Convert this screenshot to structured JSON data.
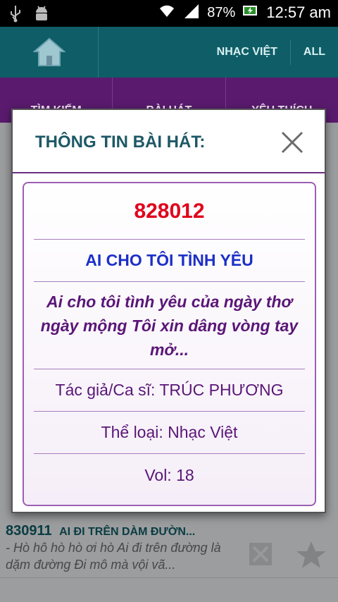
{
  "status_bar": {
    "battery": "87%",
    "time": "12:57 am"
  },
  "appbar": {
    "nav": [
      "NHẠC VIỆT",
      "ALL"
    ]
  },
  "tabs": [
    "TÌM KIẾM",
    "BÀI HÁT",
    "YÊU THÍCH"
  ],
  "list": {
    "visible_row": {
      "code": "830911",
      "title": "AI ĐI TRÊN DÀM ĐƯỜN...",
      "lyric": "- Hò hô hò hò ơi hò Ai đi trên đường là dặm đường Đi mô mà vội vã..."
    }
  },
  "dialog": {
    "title": "THÔNG TIN BÀI HÁT:",
    "song_code": "828012",
    "song_title": "AI CHO TÔI TÌNH YÊU",
    "lyric": "Ai cho tôi tình yêu của ngày thơ ngày mộng Tôi xin dâng vòng tay mở...",
    "author_line": "Tác giả/Ca sĩ: TRÚC PHƯƠNG",
    "genre_line": "Thể loại: Nhạc Việt",
    "vol_line": "Vol: 18"
  },
  "colors": {
    "appbar": "#0f5e67",
    "tabbar": "#5a1b6e",
    "code_red": "#e0001b",
    "title_blue": "#1d2fc7",
    "purple_text": "#5a1677"
  }
}
